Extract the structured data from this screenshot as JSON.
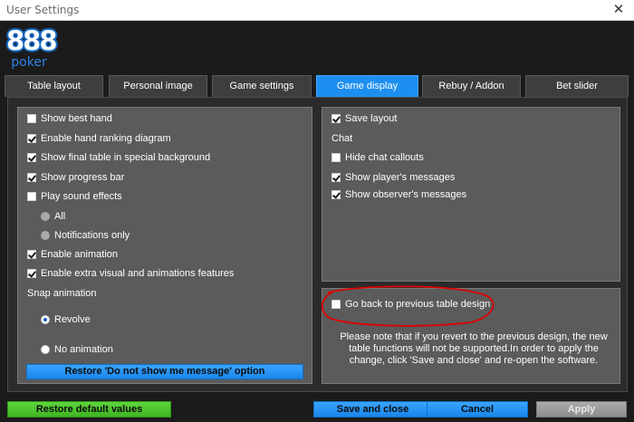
{
  "window": {
    "title": "User Settings",
    "close_glyph": "✕"
  },
  "logo": {
    "text_top": "888",
    "text_bottom": "poker",
    "color": "#1565c0"
  },
  "tabs": [
    {
      "label": "Table layout",
      "active": false
    },
    {
      "label": "Personal image",
      "active": false
    },
    {
      "label": "Game settings",
      "active": false
    },
    {
      "label": "Game display",
      "active": true
    },
    {
      "label": "Rebuy / Addon",
      "active": false
    },
    {
      "label": "Bet slider",
      "active": false
    }
  ],
  "left_panel": {
    "show_best_hand": {
      "label": "Show best hand",
      "checked": false
    },
    "hand_ranking": {
      "label": "Enable hand ranking diagram",
      "checked": true
    },
    "final_table_bg": {
      "label": "Show final table in special background",
      "checked": true
    },
    "progress_bar": {
      "label": "Show progress bar",
      "checked": true
    },
    "sound_effects": {
      "label": "Play sound effects",
      "checked": false
    },
    "sound_all": {
      "label": "All",
      "selected": false,
      "enabled": false
    },
    "sound_notifications": {
      "label": "Notifications only",
      "selected": false,
      "enabled": false
    },
    "animation": {
      "label": "Enable animation",
      "checked": true
    },
    "extra_visual": {
      "label": "Enable extra visual and animations features",
      "checked": true
    },
    "snap_label": "Snap animation",
    "snap_revolve": {
      "label": "Revolve",
      "selected": true
    },
    "snap_none": {
      "label": "No animation",
      "selected": false
    },
    "restore_message_button": "Restore 'Do not show me message' option"
  },
  "right_panel": {
    "save_layout": {
      "label": "Save layout",
      "checked": true
    },
    "chat_label": "Chat",
    "hide_callouts": {
      "label": "Hide chat callouts",
      "checked": false
    },
    "player_messages": {
      "label": "Show player's messages",
      "checked": true
    },
    "observer_messages": {
      "label": "Show observer's messages",
      "checked": true
    }
  },
  "design_panel": {
    "previous_design": {
      "label": "Go back to previous table design",
      "checked": false
    },
    "note": "Please note that if you revert to the previous design, the new table functions will not be supported.In order to apply the change, click 'Save and close' and re-open the software."
  },
  "footer": {
    "restore_defaults": "Restore default values",
    "save_close": "Save and close",
    "cancel": "Cancel",
    "apply": "Apply"
  },
  "colors": {
    "accent_blue": "#1d8ff0",
    "green_button": "#3fb623",
    "annotation_red": "#e00000"
  }
}
